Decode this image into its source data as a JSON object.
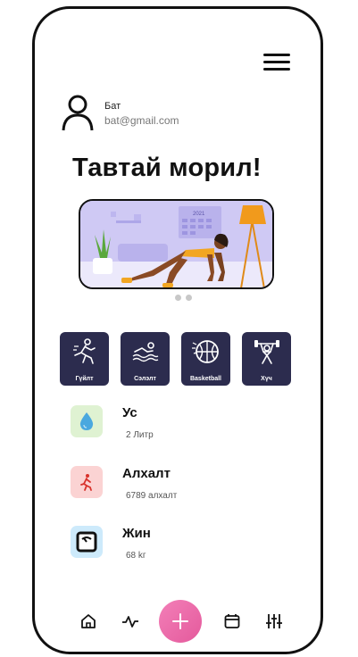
{
  "profile": {
    "name": "Бат",
    "email": "bat@gmail.com"
  },
  "greeting": "Тавтай морил!",
  "banner": {
    "calendar_year": "2021",
    "slide_count": 2,
    "active_slide": 1
  },
  "sports": [
    {
      "label": "Гүйлт",
      "icon": "running-icon"
    },
    {
      "label": "Сэлэлт",
      "icon": "swimming-icon"
    },
    {
      "label": "Basketball",
      "icon": "basketball-icon"
    },
    {
      "label": "Хүч",
      "icon": "weightlifting-icon"
    }
  ],
  "stats": [
    {
      "label": "Ус",
      "value": "2 Литр",
      "icon": "water-drop-icon",
      "bg": "#dff2d2"
    },
    {
      "label": "Алхалт",
      "value": "6789 алхалт",
      "icon": "walking-icon",
      "bg": "#fbd3d3"
    },
    {
      "label": "Жин",
      "value": "68 kг",
      "icon": "scale-icon",
      "bg": "#cdeafb"
    }
  ],
  "colors": {
    "card": "#2c2c4e",
    "fab": "#e86aa8",
    "water": "#4aa8df"
  }
}
